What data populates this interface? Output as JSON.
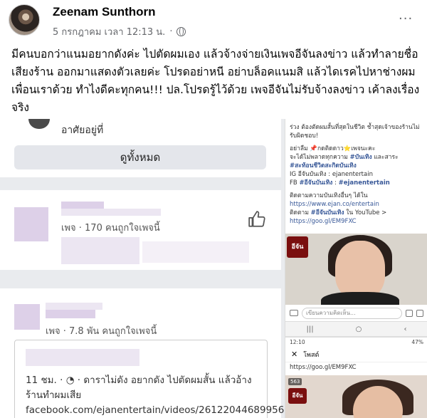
{
  "post": {
    "author": "Zeenam Sunthorn",
    "timestamp": "5 กรกฎาคม เวลา 12:13 น.",
    "separator": "·",
    "privacy_icon": "globe-icon",
    "more_label": "···",
    "text": "มีคนบอกว่าแนมอยากดังค่ะ ไปตัดผมเอง แล้วจ้างจ่ายเงินเพจอีจันลงข่าว แล้วทำลายชื่อเสียงร้าน ออกมาแสดงตัวเลยค่ะ โปรดอย่าหนี อย่าบล็อคแนมสิ แล้วไดเรคไปหาช่างผมเพื่อนเราด้วย ทำไงดีคะทุกคน!!! ปล.โปรดรู้ไว้ด้วย เพจอีจันไม่รับจ้างลงข่าว เค้าลงเรื่องจริง"
  },
  "left_shot": {
    "lives_in": "อาศัยอยู่ที่",
    "see_all": "ดูทั้งหมด",
    "page1_likes": "เพจ · 170 คนถูกใจเพจนี้",
    "page2_likes": "เพจ · 7.8 พัน คนถูกใจเพจนี้",
    "shared_post": "11 ชม. · ◔ · ดาราไม่ดัง อยากดัง ไปตัดผมสั้น แล้วอ้าง ร้านทำผมเสีย facebook.com/ejanentertain/videos/2612204468995674/"
  },
  "right_shot": {
    "line1": "ร่วง ต้องตัดผมสั้นที่สุดในชีวิต ช้ำสุดเจ้าของร้านไม่รับผิดชอบ!",
    "line2": "อย่าลืม 📌กดติดดาว⭐เพจนะคะ",
    "line3": "จะได้ไม่พลาดทุกความ",
    "tag1": "#บันเทิง",
    "line3b": "และสาระ",
    "tag2": "#สะท้อนชีวิตสะกิดบันเทิง",
    "ig": "IG อีจันบันเทิง : ejanentertain",
    "fb_prefix": "FB",
    "fb_tag1": "#อีจันบันเทิง",
    "fb_tag2": "#ejanentertain",
    "follow1": "ติดตามความบันเทิงอื่นๆ ได้ใน",
    "link1": "https://www.ejan.co/entertain",
    "follow2_prefix": "ติดตาม",
    "follow2_tag": "#อีจันบันเทิง",
    "follow2_suffix": "ใน YouTube >",
    "link2": "https://goo.gl/EM9FXC",
    "video_logo": "อีจัน",
    "comment_placeholder": "เขียนความคิดเห็น...",
    "nav_back": "‹",
    "nav_home": "○",
    "nav_recent": "|||",
    "status_time": "12:10",
    "status_right": "47%",
    "post_header": "โพสต์",
    "link3": "https://goo.gl/EM9FXC",
    "views": "563",
    "thumb_logo": "อีจัน"
  }
}
